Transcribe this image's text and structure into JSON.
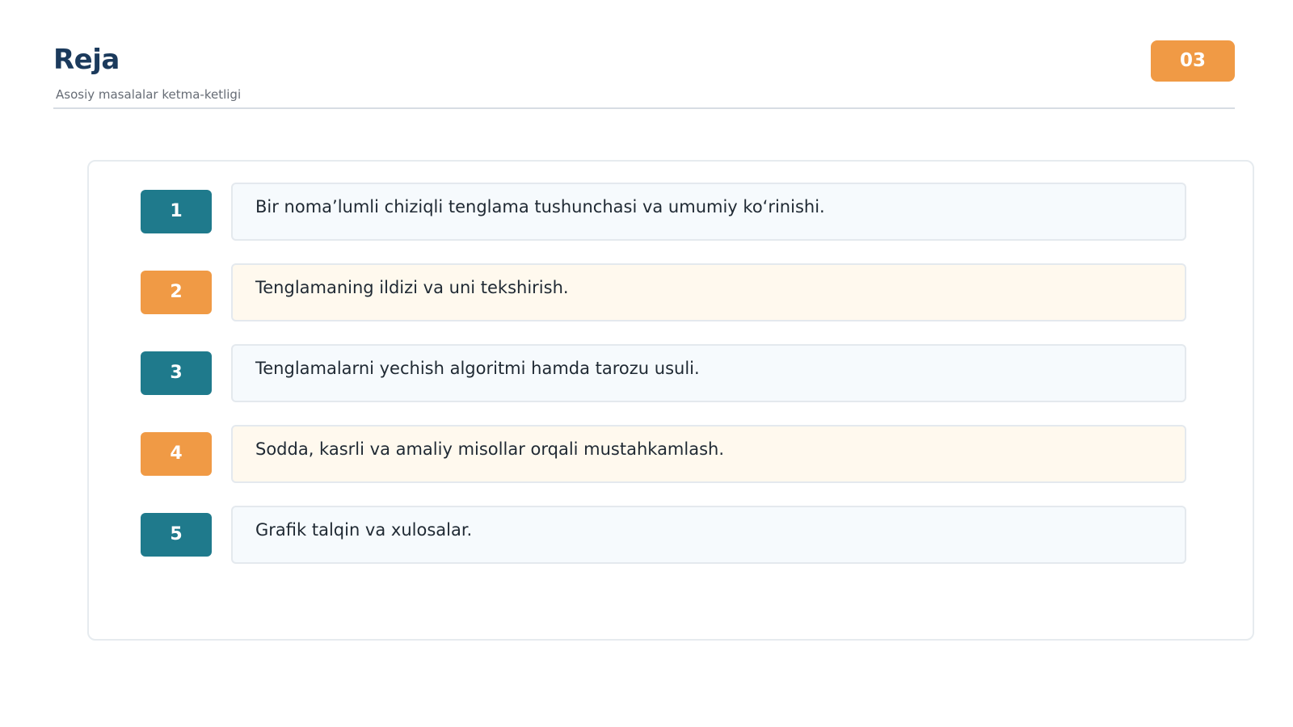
{
  "header": {
    "title": "Reja",
    "subtitle": "Asosiy masalalar ketma-ketligi",
    "page_number": "03"
  },
  "colors": {
    "title": "#1b3a5c",
    "teal_accent": "#1f7a8c",
    "orange_accent": "#f09a45"
  },
  "items": [
    {
      "number": "1",
      "text": "Bir noma’lumli chiziqli tenglama tushunchasi va umumiy ko‘rinishi."
    },
    {
      "number": "2",
      "text": "Tenglamaning ildizi va uni tekshirish."
    },
    {
      "number": "3",
      "text": "Tenglamalarni yechish algoritmi hamda tarozu usuli."
    },
    {
      "number": "4",
      "text": "Sodda, kasrli va amaliy misollar orqali mustahkamlash."
    },
    {
      "number": "5",
      "text": "Grafik talqin va xulosalar."
    }
  ]
}
